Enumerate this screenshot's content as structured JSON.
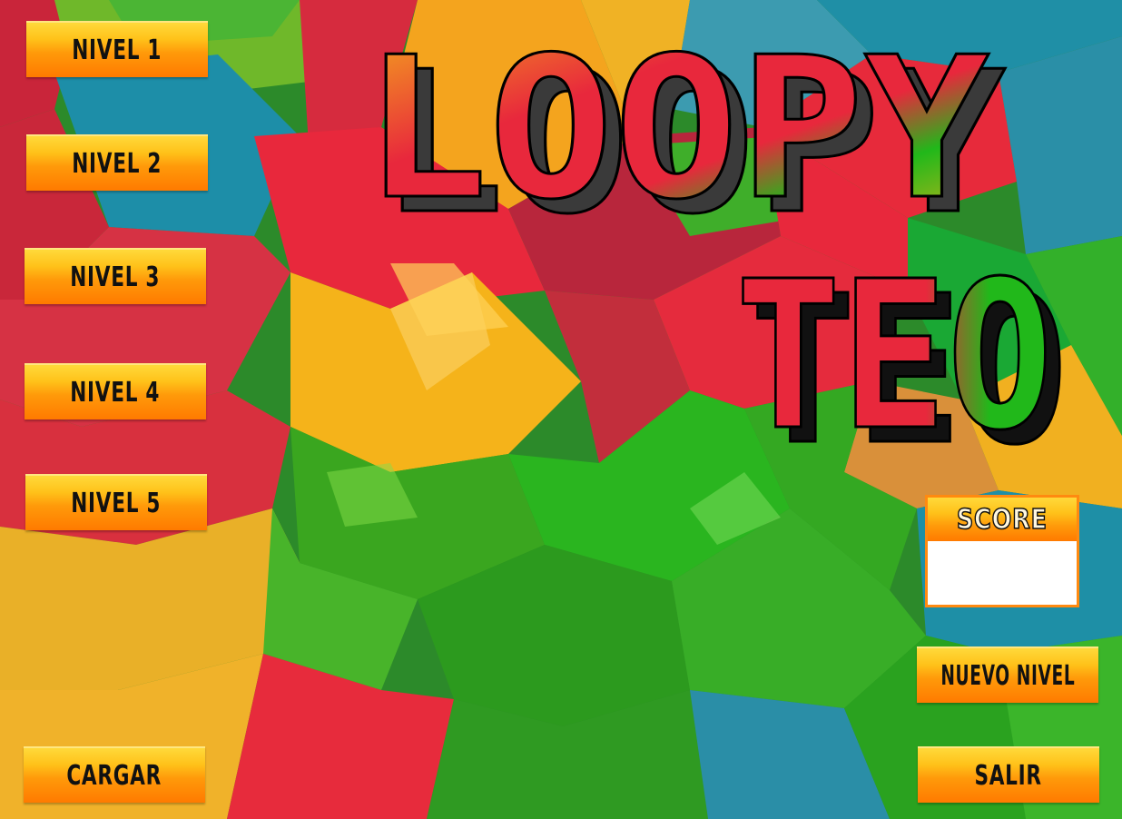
{
  "levels": [
    {
      "label": "NIVEL 1"
    },
    {
      "label": "NIVEL 2"
    },
    {
      "label": "NIVEL 3"
    },
    {
      "label": "NIVEL 4"
    },
    {
      "label": "NIVEL 5"
    }
  ],
  "load_label": "CARGAR",
  "title": {
    "line1": "LOOPY",
    "line2": "TEO"
  },
  "score": {
    "label": "SCORE",
    "value": ""
  },
  "new_level_label": "NUEVO NIVEL",
  "exit_label": "SALIR",
  "colors": {
    "button_top": "#ffd93a",
    "button_bottom": "#ff7a00",
    "score_border": "#ff8a10",
    "title_red": "#e8283c",
    "title_yellow": "#f5b31a",
    "title_green": "#21b81a",
    "title_shadow": "#3a3a3a"
  }
}
